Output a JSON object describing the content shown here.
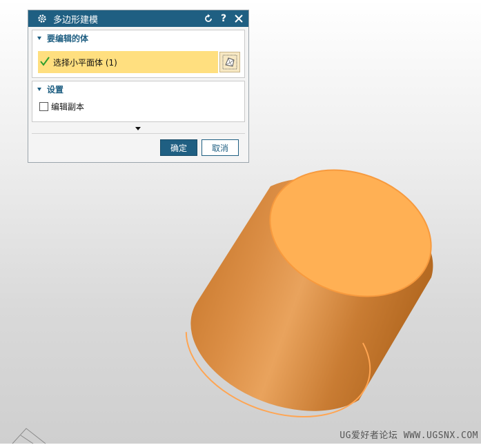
{
  "dialog": {
    "title": "多边形建模",
    "reset_icon": "reset-icon",
    "help_icon": "help-icon",
    "close_icon": "close-icon",
    "settings_icon": "gear-icon",
    "section_body": {
      "label": "要编辑的体",
      "select_label": "选择小平面体 (1)",
      "select_button_icon": "facet-body-select-icon"
    },
    "section_settings": {
      "label": "设置",
      "checkbox_label": "编辑副本",
      "checkbox_checked": false
    },
    "ok_label": "确定",
    "cancel_label": "取消"
  },
  "viewport": {
    "object": "cylinder",
    "object_color": "#f0a24c"
  },
  "watermark": "UG爱好者论坛 WWW.UGSNX.COM"
}
